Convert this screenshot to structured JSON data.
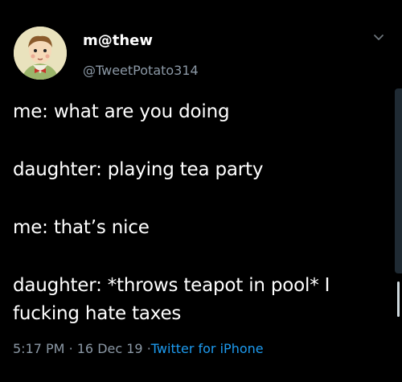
{
  "tweet": {
    "display_name": "m@thew",
    "handle": "@TweetPotato314",
    "lines": [
      "me: what are you doing",
      "daughter: playing tea party",
      "me: that’s nice",
      "daughter: *throws teapot in pool* I",
      "fucking hate taxes"
    ],
    "time": "5:17 PM",
    "separator": "·",
    "date": "16 Dec 19",
    "source": "Twitter for iPhone"
  },
  "colors": {
    "background": "#000000",
    "secondary_text": "#8b98a5",
    "link": "#1d9bf0"
  },
  "icons": {
    "menu": "chevron-down-icon",
    "avatar": "cartoon-boy-avatar"
  }
}
